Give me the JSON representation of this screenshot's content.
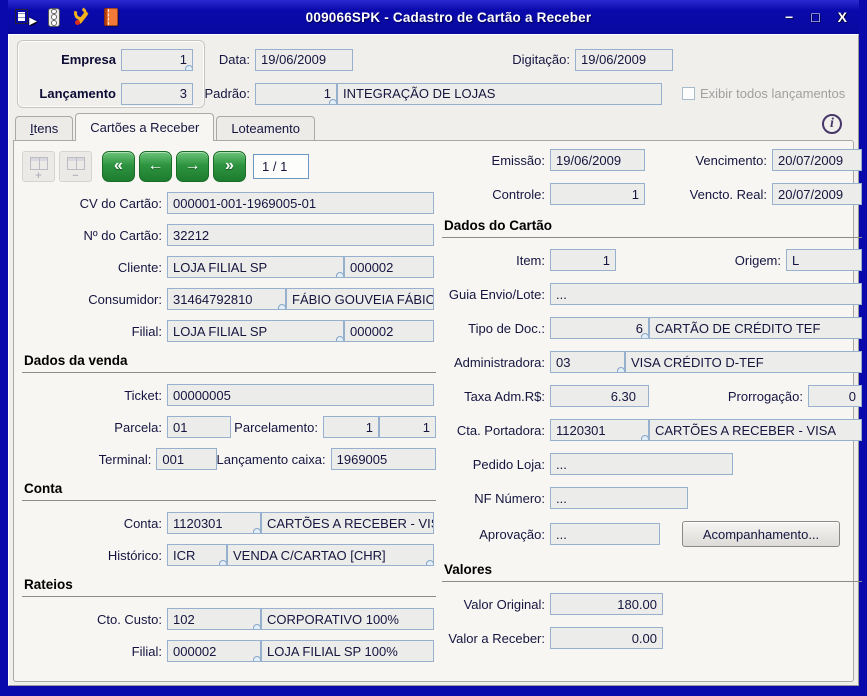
{
  "colors": {
    "titlebar": "#0a0aac",
    "field_border": "#96b0ce",
    "field_bg": "#ececea",
    "nav_green": "#2e9440",
    "info_purple": "#473668"
  },
  "titlebar": {
    "title": "009066SPK - Cadastro de Cartão a Receber",
    "minimize": "−",
    "maximize": "□",
    "close": "X",
    "icons": [
      "exit-icon",
      "traffic-light-icon",
      "wrench-icon",
      "notebook-icon"
    ]
  },
  "top": {
    "empresa_label": "Empresa",
    "empresa_value": "1",
    "lancamento_label": "Lançamento",
    "lancamento_value": "3",
    "data_label": "Data:",
    "data_value": "19/06/2009",
    "digitacao_label": "Digitação:",
    "digitacao_value": "19/06/2009",
    "padrao_label": "Padrão:",
    "padrao_code": "1",
    "padrao_desc": "INTEGRAÇÃO DE LOJAS",
    "exibir_label": "Exibir todos lançamentos",
    "exibir_checked": false
  },
  "tabs": {
    "itens": "Itens",
    "cartoes": "Cartões a Receber",
    "loteamento": "Loteamento",
    "active": "Cartões a Receber"
  },
  "toolbar": {
    "first": "«",
    "prev": "←",
    "next": "→",
    "last": "»",
    "counter": "1 / 1",
    "add": "+",
    "remove": "−"
  },
  "left": {
    "cv_label": "CV do Cartão:",
    "cv_value": "000001-001-1969005-01",
    "num_label": "Nº do Cartão:",
    "num_value": "32212",
    "cliente_label": "Cliente:",
    "cliente_name": "LOJA FILIAL SP",
    "cliente_code": "000002",
    "consumidor_label": "Consumidor:",
    "consumidor_code": "31464792810",
    "consumidor_name": "FÁBIO GOUVEIA FÁBIO GOUVEI",
    "filial_label": "Filial:",
    "filial_name": "LOJA FILIAL SP",
    "filial_code": "000002",
    "venda_title": "Dados da venda",
    "ticket_label": "Ticket:",
    "ticket_value": "00000005",
    "parcela_label": "Parcela:",
    "parcela_value": "01",
    "parcelamento_label": "Parcelamento:",
    "parcelamento_v1": "1",
    "parcelamento_v2": "1",
    "terminal_label": "Terminal:",
    "terminal_value": "001",
    "lcx_label": "Lançamento caixa:",
    "lcx_value": "1969005",
    "conta_title": "Conta",
    "conta_label": "Conta:",
    "conta_code": "1120301",
    "conta_desc": "CARTÕES A RECEBER - VISA",
    "historico_label": "Histórico:",
    "historico_code": "ICR",
    "historico_desc": "VENDA C/CARTAO [CHR]",
    "rateios_title": "Rateios",
    "ctocusto_label": "Cto. Custo:",
    "ctocusto_code": "102",
    "ctocusto_desc": "CORPORATIVO 100%",
    "rfilial_label": "Filial:",
    "rfilial_code": "000002",
    "rfilial_desc": "LOJA FILIAL SP 100%"
  },
  "right": {
    "emissao_label": "Emissão:",
    "emissao_value": "19/06/2009",
    "vencimento_label": "Vencimento:",
    "vencimento_value": "20/07/2009",
    "controle_label": "Controle:",
    "controle_value": "1",
    "venctoreal_label": "Vencto. Real:",
    "venctoreal_value": "20/07/2009",
    "cartao_title": "Dados do Cartão",
    "item_label": "Item:",
    "item_value": "1",
    "origem_label": "Origem:",
    "origem_value": "L",
    "guia_label": "Guia Envio/Lote:",
    "guia_value": "...",
    "tipodoc_label": "Tipo de Doc.:",
    "tipodoc_code": "6",
    "tipodoc_desc": "CARTÃO DE CRÉDITO TEF",
    "adm_label": "Administradora:",
    "adm_code": "03",
    "adm_desc": "VISA CRÉDITO D-TEF",
    "taxa_label": "Taxa Adm.R$:",
    "taxa_value": "6.30",
    "prorrogacao_label": "Prorrogação:",
    "prorrogacao_value": "0",
    "ctaport_label": "Cta. Portadora:",
    "ctaport_code": "1120301",
    "ctaport_desc": "CARTÕES A RECEBER - VISA",
    "pedido_label": "Pedido Loja:",
    "pedido_value": "...",
    "nf_label": "NF Número:",
    "nf_value": "...",
    "aprovacao_label": "Aprovação:",
    "aprovacao_value": "...",
    "acompanhamento_button": "Acompanhamento...",
    "valores_title": "Valores",
    "valororig_label": "Valor Original:",
    "valororig_value": "180.00",
    "valorrec_label": "Valor a Receber:",
    "valorrec_value": "0.00"
  },
  "info_icon_glyph": "i"
}
